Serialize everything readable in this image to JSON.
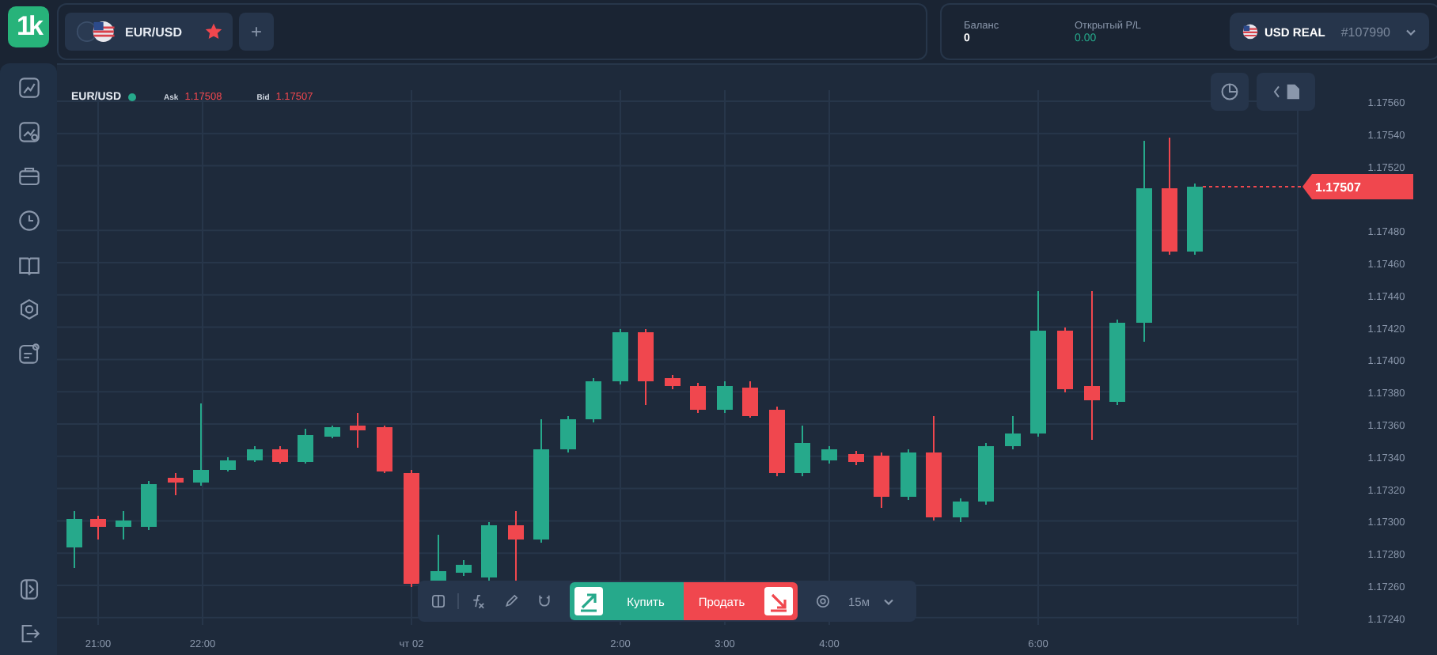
{
  "logo": "1k",
  "tabs": [
    {
      "symbol": "EUR/USD",
      "favorite": true,
      "selected": true
    }
  ],
  "add_tab": "+",
  "account": {
    "balance_label": "Баланс",
    "balance": "0",
    "pl_label": "Открытый P/L",
    "pl": "0.00",
    "currency": "USD REAL",
    "account_number": "#107990"
  },
  "chart": {
    "symbol": "EUR/USD",
    "live": true,
    "ask_label": "Ask",
    "ask": "1.17508",
    "bid_label": "Bid",
    "bid": "1.17507",
    "current_price": "1.17507",
    "y_ticks": [
      "1.17560",
      "1.17540",
      "1.17520",
      "1.17480",
      "1.17460",
      "1.17440",
      "1.17420",
      "1.17400",
      "1.17380",
      "1.17360",
      "1.17340",
      "1.17320",
      "1.17300",
      "1.17280",
      "1.17260",
      "1.17240"
    ],
    "x_ticks": [
      "21:00",
      "22:00",
      "чт 02",
      "2:00",
      "3:00",
      "4:00",
      "6:00"
    ]
  },
  "toolbar": {
    "buy": "Купить",
    "sell": "Продать",
    "interval": "15м"
  }
}
